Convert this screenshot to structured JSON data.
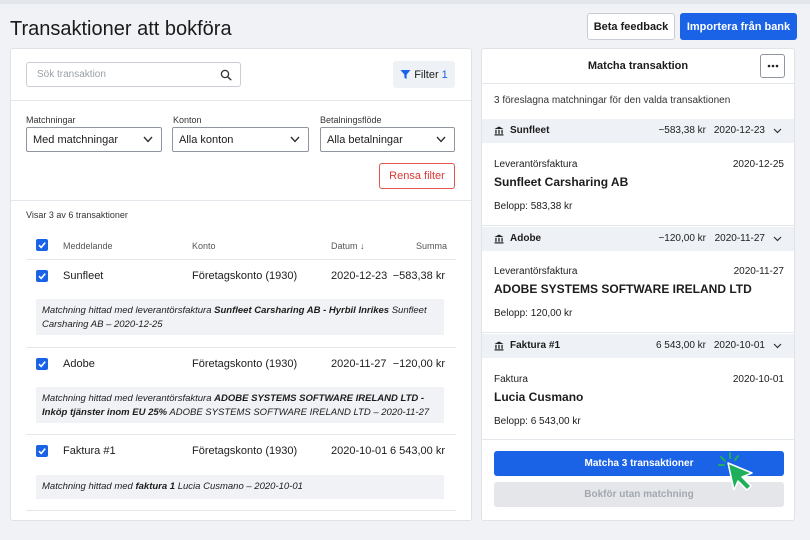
{
  "page": {
    "title": "Transaktioner att bokföra",
    "beta_label": "Beta feedback",
    "import_label": "Importera från bank"
  },
  "filters": {
    "search_placeholder": "Sök transaktion",
    "filter_label": "Filter",
    "filter_count": "1",
    "matchningar_label": "Matchningar",
    "matchningar_value": "Med matchningar",
    "konton_label": "Konton",
    "konton_value": "Alla konton",
    "betalningsflode_label": "Betalningsflöde",
    "betalningsflode_value": "Alla betalningar",
    "clear_label": "Rensa filter"
  },
  "table": {
    "showing": "Visar 3 av 6 transaktioner",
    "col_message": "Meddelande",
    "col_account": "Konto",
    "col_date": "Datum ↓",
    "col_sum": "Summa",
    "rows": [
      {
        "message": "Sunfleet",
        "account": "Företagskonto (1930)",
        "date": "2020-12-23",
        "sum": "−583,38 kr",
        "note_prefix": "Matchning hittad med leverantörsfaktura ",
        "note_bold": "Sunfleet Carsharing AB - Hyrbil Inrikes",
        "note_suffix": " Sunfleet Carsharing AB – 2020-12-25"
      },
      {
        "message": "Adobe",
        "account": "Företagskonto (1930)",
        "date": "2020-11-27",
        "sum": "−120,00 kr",
        "note_prefix": "Matchning hittad med leverantörsfaktura ",
        "note_bold": "ADOBE SYSTEMS SOFTWARE IRELAND LTD - Inköp tjänster inom EU 25%",
        "note_suffix": " ADOBE SYSTEMS SOFTWARE IRELAND LTD – 2020-11-27"
      },
      {
        "message": "Faktura #1",
        "account": "Företagskonto (1930)",
        "date": "2020-10-01",
        "sum": "6 543,00 kr",
        "note_prefix": "Matchning hittad med ",
        "note_bold": "faktura 1",
        "note_suffix": " Lucia Cusmano – 2020-10-01"
      }
    ]
  },
  "match": {
    "title": "Matcha transaktion",
    "suggest_text": "3 föreslagna matchningar för den valda transaktionen",
    "groups": [
      {
        "name": "Sunfleet",
        "amount": "−583,38 kr",
        "date": "2020-12-23",
        "type": "Leverantörsfaktura",
        "doc_date": "2020-12-25",
        "vendor": "Sunfleet Carsharing AB",
        "belopp": "Belopp: 583,38 kr"
      },
      {
        "name": "Adobe",
        "amount": "−120,00 kr",
        "date": "2020-11-27",
        "type": "Leverantörsfaktura",
        "doc_date": "2020-11-27",
        "vendor": "ADOBE SYSTEMS SOFTWARE IRELAND LTD",
        "belopp": "Belopp: 120,00 kr"
      },
      {
        "name": "Faktura #1",
        "amount": "6 543,00 kr",
        "date": "2020-10-01",
        "type": "Faktura",
        "doc_date": "2020-10-01",
        "vendor": "Lucia Cusmano",
        "belopp": "Belopp: 6 543,00 kr"
      }
    ],
    "match_button": "Matcha 3 transaktioner",
    "book_button": "Bokför utan matchning"
  },
  "colors": {
    "primary": "#1a62e6",
    "danger": "#d93a36",
    "cursor": "#1fae5b"
  }
}
